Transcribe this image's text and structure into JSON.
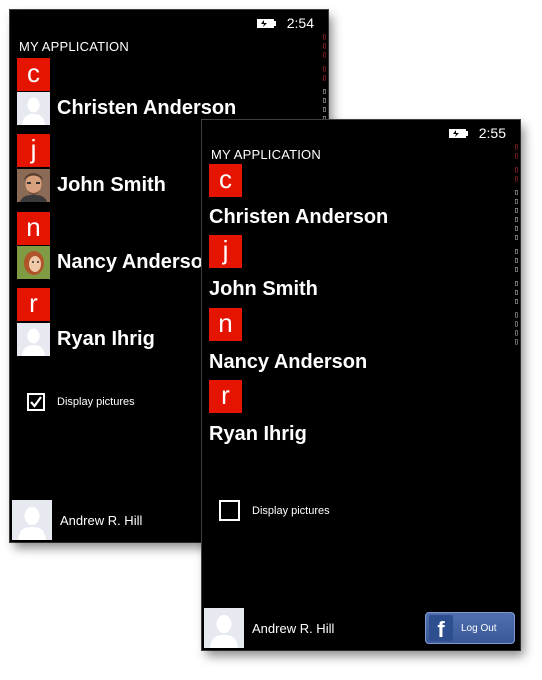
{
  "colors": {
    "accent": "#e51400",
    "background": "#000000",
    "facebook": "#3b5998"
  },
  "screen1": {
    "time": "2:54",
    "app_title": "MY APPLICATION",
    "groups": [
      {
        "letter": "c",
        "name": "Christen Anderson"
      },
      {
        "letter": "j",
        "name": "John Smith"
      },
      {
        "letter": "n",
        "name": "Nancy Anderson"
      },
      {
        "letter": "r",
        "name": "Ryan Ihrig"
      }
    ],
    "checkbox_label": "Display pictures",
    "checkbox_checked": true,
    "user_name": "Andrew R. Hill"
  },
  "screen2": {
    "time": "2:55",
    "app_title": "MY APPLICATION",
    "groups": [
      {
        "letter": "c",
        "name": "Christen Anderson"
      },
      {
        "letter": "j",
        "name": "John Smith"
      },
      {
        "letter": "n",
        "name": "Nancy Anderson"
      },
      {
        "letter": "r",
        "name": "Ryan Ihrig"
      }
    ],
    "checkbox_label": "Display pictures",
    "checkbox_checked": false,
    "user_name": "Andrew R. Hill",
    "logout_label": "Log Out",
    "fb_glyph": "f"
  }
}
